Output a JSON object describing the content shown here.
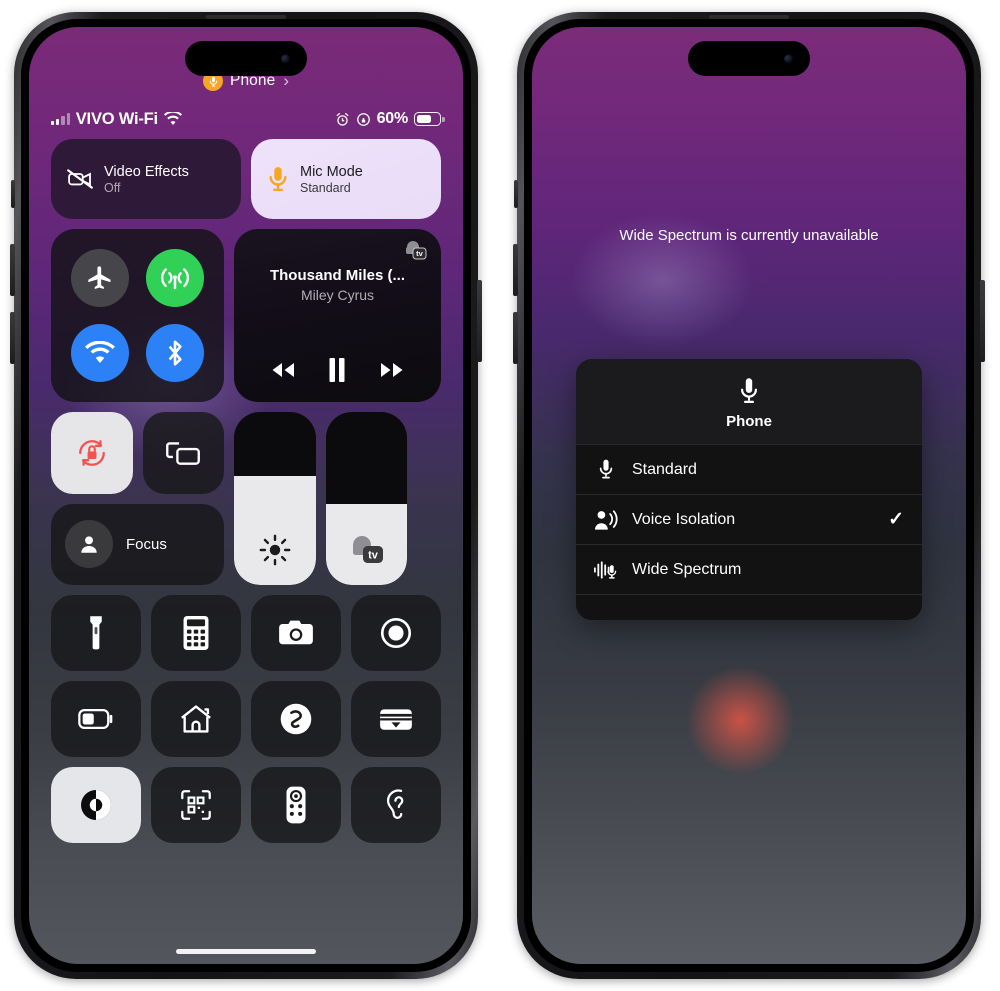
{
  "left_phone": {
    "control_center_pill": {
      "label": "Phone",
      "icon": "microphone-icon",
      "chevron": "›",
      "dot_color": "#F5A623"
    },
    "status_bar": {
      "carrier": "VIVO Wi-Fi",
      "signal_icon": "cellular-bars-icon",
      "wifi_icon": "wifi-icon",
      "alarm_icon": "alarm-clock-icon",
      "orientation_lock_icon": "rotation-lock-status-icon",
      "battery_percent": "60%",
      "battery_icon": "battery-icon"
    },
    "effects": [
      {
        "name": "video-effects",
        "title": "Video Effects",
        "subtitle": "Off",
        "icon": "video-slash-icon",
        "active": false
      },
      {
        "name": "mic-mode",
        "title": "Mic Mode",
        "subtitle": "Standard",
        "icon": "microphone-icon",
        "active": true,
        "icon_color": "#F5A623"
      }
    ],
    "connectivity": [
      {
        "name": "airplane-mode",
        "icon": "airplane-icon",
        "state": "off",
        "color": "#46464a"
      },
      {
        "name": "cellular-data",
        "icon": "cellular-antenna-icon",
        "state": "on",
        "color": "#31d158"
      },
      {
        "name": "wifi",
        "icon": "wifi-icon",
        "state": "on",
        "color": "#2c81f6"
      },
      {
        "name": "bluetooth",
        "icon": "bluetooth-icon",
        "state": "on",
        "color": "#2c81f6"
      }
    ],
    "media": {
      "title": "Thousand Miles (...",
      "artist": "Miley Cyrus",
      "source_icon": "airplay-apple-tv-icon",
      "controls": [
        {
          "name": "previous-track",
          "icon": "rewind-icon"
        },
        {
          "name": "play-pause",
          "icon": "pause-icon"
        },
        {
          "name": "next-track",
          "icon": "fast-forward-icon"
        }
      ]
    },
    "mid_controls": {
      "rotation_lock": {
        "name": "rotation-lock",
        "icon": "rotation-lock-icon",
        "active": true,
        "accent": "#f4524d"
      },
      "screen_mirroring": {
        "name": "screen-mirroring",
        "icon": "screen-mirroring-icon",
        "active": false
      },
      "focus": {
        "name": "focus",
        "label": "Focus",
        "icon": "person-icon"
      },
      "brightness": {
        "name": "brightness-slider",
        "icon": "sun-icon",
        "value": 63
      },
      "volume": {
        "name": "volume-slider",
        "icon": "airplay-apple-tv-icon",
        "value": 47
      }
    },
    "shortcut_grid": [
      {
        "name": "flashlight",
        "icon": "flashlight-icon",
        "active": false
      },
      {
        "name": "calculator",
        "icon": "calculator-icon",
        "active": false
      },
      {
        "name": "camera",
        "icon": "camera-icon",
        "active": false
      },
      {
        "name": "screen-record",
        "icon": "screen-record-icon",
        "active": false
      },
      {
        "name": "low-power-mode",
        "icon": "battery-low-icon",
        "active": false
      },
      {
        "name": "home",
        "icon": "home-icon",
        "active": false
      },
      {
        "name": "shazam",
        "icon": "shazam-icon",
        "active": false
      },
      {
        "name": "wallet",
        "icon": "wallet-icon",
        "active": false
      },
      {
        "name": "dark-mode",
        "icon": "dark-mode-icon",
        "active": true
      },
      {
        "name": "code-scanner",
        "icon": "qr-scanner-icon",
        "active": false
      },
      {
        "name": "apple-tv-remote",
        "icon": "remote-icon",
        "active": false
      },
      {
        "name": "hearing",
        "icon": "ear-icon",
        "active": false
      }
    ],
    "home_indicator": "home-indicator"
  },
  "right_phone": {
    "notice": "Wide Spectrum is currently unavailable",
    "menu": {
      "header_icon": "microphone-icon",
      "header_label": "Phone",
      "options": [
        {
          "name": "mic-mode-standard",
          "label": "Standard",
          "icon": "microphone-icon",
          "selected": false
        },
        {
          "name": "mic-mode-voice-isolation",
          "label": "Voice Isolation",
          "icon": "voice-isolation-icon",
          "selected": true,
          "check": "✓"
        },
        {
          "name": "mic-mode-wide-spectrum",
          "label": "Wide Spectrum",
          "icon": "wide-spectrum-icon",
          "selected": false
        }
      ]
    }
  }
}
